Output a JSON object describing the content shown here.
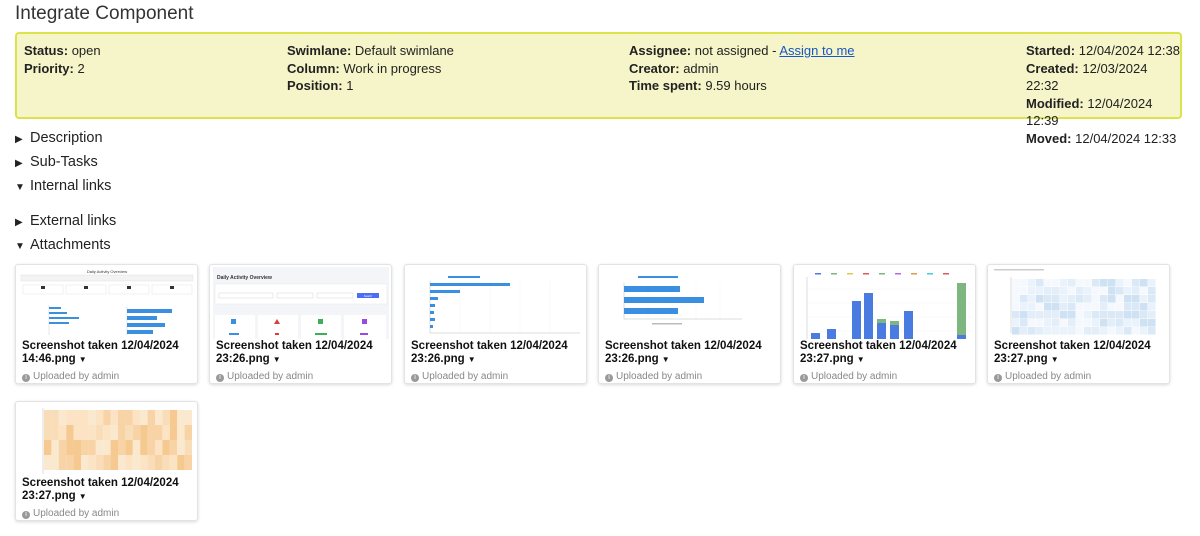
{
  "task": {
    "title": "Integrate Component"
  },
  "summary": {
    "col1": [
      {
        "label": "Status:",
        "value": "open"
      },
      {
        "label": "Priority:",
        "value": "2"
      }
    ],
    "col2": [
      {
        "label": "Swimlane:",
        "value": "Default swimlane"
      },
      {
        "label": "Column:",
        "value": "Work in progress"
      },
      {
        "label": "Position:",
        "value": "1"
      }
    ],
    "col3": {
      "assignee_label": "Assignee:",
      "assignee_value": "not assigned",
      "assignee_sep": "-",
      "assign_link": "Assign to me",
      "creator_label": "Creator:",
      "creator_value": "admin",
      "time_label": "Time spent:",
      "time_value": "9.59 hours"
    },
    "col4": [
      {
        "label": "Started:",
        "value": "12/04/2024 12:38"
      },
      {
        "label": "Created:",
        "value": "12/03/2024 22:32"
      },
      {
        "label": "Modified:",
        "value": "12/04/2024 12:39"
      },
      {
        "label": "Moved:",
        "value": "12/04/2024 12:33"
      }
    ]
  },
  "sections": [
    {
      "label": "Description",
      "icon": "triangle-right",
      "expanded": false
    },
    {
      "label": "Sub-Tasks",
      "icon": "triangle-right",
      "expanded": false
    },
    {
      "label": "Internal links",
      "icon": "triangle-down",
      "expanded": true
    },
    {
      "label": "External links",
      "icon": "triangle-right",
      "expanded": false
    },
    {
      "label": "Attachments",
      "icon": "triangle-down",
      "expanded": true
    }
  ],
  "attachments": [
    {
      "line1": "Screenshot taken 12/04/2024",
      "line2": "14:46.png",
      "uploaded": "Uploaded by admin"
    },
    {
      "line1": "Screenshot taken 12/04/2024",
      "line2": "23:26.png",
      "uploaded": "Uploaded by admin"
    },
    {
      "line1": "Screenshot taken 12/04/2024",
      "line2": "23:26.png",
      "uploaded": "Uploaded by admin"
    },
    {
      "line1": "Screenshot taken 12/04/2024",
      "line2": "23:26.png",
      "uploaded": "Uploaded by admin"
    },
    {
      "line1": "Screenshot taken 12/04/2024",
      "line2": "23:27.png",
      "uploaded": "Uploaded by admin"
    },
    {
      "line1": "Screenshot taken 12/04/2024",
      "line2": "23:27.png",
      "uploaded": "Uploaded by admin"
    },
    {
      "line1": "Screenshot taken 12/04/2024",
      "line2": "23:27.png",
      "uploaded": "Uploaded by admin"
    }
  ],
  "thumbnails": {
    "t1_title": "Daily Activity Overview",
    "t2_title": "Daily Activity Overview",
    "t2_button": "Search"
  },
  "colors": {
    "summary_bg": "#f5f5c9",
    "summary_border": "#dbe24a",
    "link": "#1a55c7",
    "bar_blue": "#3a8fe0",
    "chart_blue": "#4a7be0",
    "chart_green": "#7fb57f",
    "heat_orange": "#f7d8ae"
  }
}
